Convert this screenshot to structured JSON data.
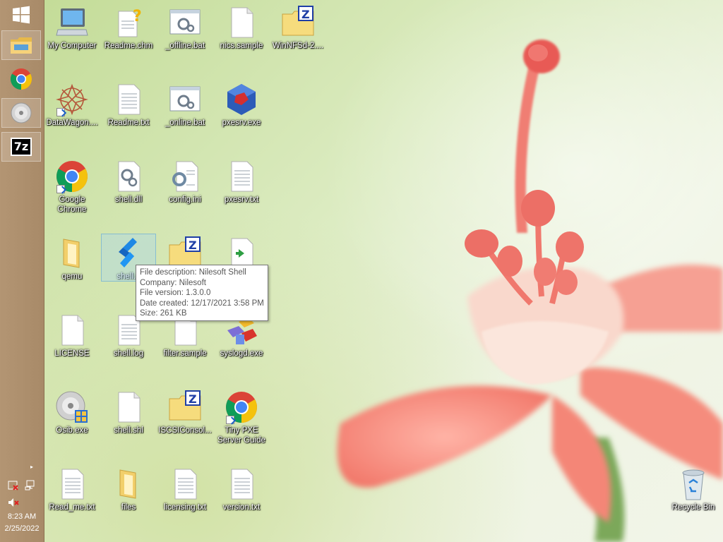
{
  "taskbar": {
    "clock_time": "8:23 AM",
    "clock_date": "2/25/2022",
    "pinned": [
      {
        "name": "start-icon"
      },
      {
        "name": "file-explorer-icon"
      },
      {
        "name": "chrome-icon"
      },
      {
        "name": "disc-icon"
      },
      {
        "name": "7zip-icon",
        "text": "7z"
      }
    ],
    "tray_arrow": "▸"
  },
  "desktop": {
    "icons": [
      {
        "label": "My Computer",
        "icon": "computer-icon"
      },
      {
        "label": "Readme.chm",
        "icon": "help-file-icon"
      },
      {
        "label": "_offline.bat",
        "icon": "batch-file-icon"
      },
      {
        "label": "nics.sample",
        "icon": "blank-file-icon"
      },
      {
        "label": "WinNFSd-2....",
        "icon": "zip-folder-icon"
      },
      {
        "label": "DataWagon....",
        "icon": "datawagon-icon"
      },
      {
        "label": "Readme.txt",
        "icon": "text-file-icon"
      },
      {
        "label": "_online.bat",
        "icon": "batch-file-icon"
      },
      {
        "label": "pxesrv.exe",
        "icon": "pxesrv-icon"
      },
      {
        "label": "Google Chrome",
        "icon": "chrome-icon"
      },
      {
        "label": "shell.dll",
        "icon": "dll-file-icon"
      },
      {
        "label": "config.ini",
        "icon": "ini-file-icon"
      },
      {
        "label": "pxesrv.txt",
        "icon": "text-file-icon"
      },
      {
        "label": "qemu",
        "icon": "folder-icon"
      },
      {
        "label": "shell.e",
        "icon": "nilesoft-shell-icon"
      },
      {
        "label": "",
        "icon": "zip-folder-icon"
      },
      {
        "label": "",
        "icon": "script-file-icon"
      },
      {
        "label": "LICENSE",
        "icon": "blank-file-icon"
      },
      {
        "label": "shell.log",
        "icon": "text-file-icon"
      },
      {
        "label": "filter.sample",
        "icon": "blank-file-icon"
      },
      {
        "label": "syslogd.exe",
        "icon": "syslogd-icon"
      },
      {
        "label": "Osib.exe",
        "icon": "disc-setup-icon"
      },
      {
        "label": "shell.shl",
        "icon": "blank-file-icon"
      },
      {
        "label": "ISCSIConsol...",
        "icon": "zip-folder-icon"
      },
      {
        "label": "Tiny PXE Server Guide",
        "icon": "chrome-icon"
      },
      {
        "label": "Read_me.txt",
        "icon": "text-file-icon"
      },
      {
        "label": "files",
        "icon": "folder-icon"
      },
      {
        "label": "licensing.txt",
        "icon": "text-file-icon"
      },
      {
        "label": "version.txt",
        "icon": "text-file-icon"
      },
      {
        "label": "Recycle Bin",
        "icon": "recycle-bin-icon"
      }
    ]
  },
  "tooltip": {
    "line1": "File description: Nilesoft Shell",
    "line2": "Company: Nilesoft",
    "line3": "File version: 1.3.0.0",
    "line4": "Date created: 12/17/2021 3:58 PM",
    "line5": "Size: 261 KB"
  },
  "colors": {
    "taskbar": "#a88a68",
    "tooltip_border": "#767676",
    "selection": "#add8e6"
  }
}
